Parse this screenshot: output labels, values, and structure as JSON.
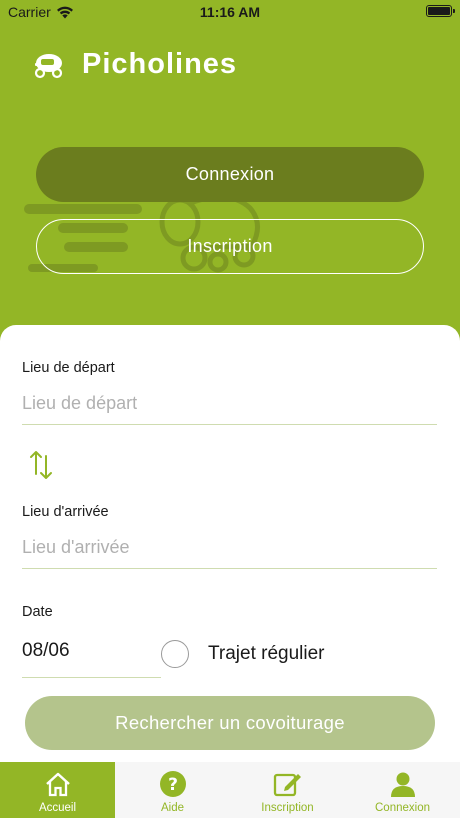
{
  "status_bar": {
    "carrier": "Carrier",
    "time": "11:16 AM"
  },
  "brand": {
    "title": "Picholines"
  },
  "auth": {
    "login_label": "Connexion",
    "register_label": "Inscription"
  },
  "form": {
    "departure_label": "Lieu de départ",
    "departure_placeholder": "Lieu de départ",
    "arrival_label": "Lieu d'arrivée",
    "arrival_placeholder": "Lieu d'arrivée",
    "date_label": "Date",
    "date_value": "08/06",
    "recurring_label": "Trajet régulier",
    "search_label": "Rechercher un covoiturage"
  },
  "tabbar": {
    "items": [
      {
        "label": "Accueil",
        "icon": "home-icon",
        "active": true
      },
      {
        "label": "Aide",
        "icon": "help-icon",
        "active": false
      },
      {
        "label": "Inscription",
        "icon": "edit-icon",
        "active": false
      },
      {
        "label": "Connexion",
        "icon": "user-icon",
        "active": false
      }
    ]
  },
  "colors": {
    "brand_green": "#93b626",
    "dark_green": "#6b7d1e",
    "search_button": "#b4c48c",
    "white": "#ffffff"
  }
}
